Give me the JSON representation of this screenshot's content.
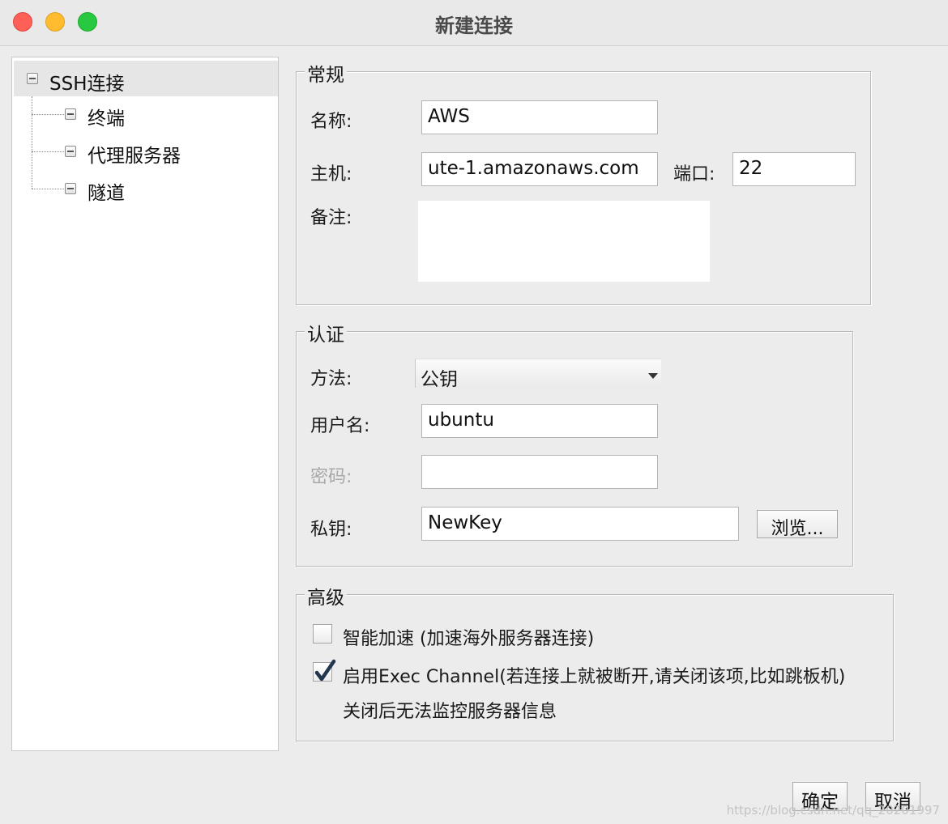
{
  "window": {
    "title": "新建连接"
  },
  "tree": {
    "root": "SSH连接",
    "children": [
      "终端",
      "代理服务器",
      "隧道"
    ]
  },
  "general": {
    "legend": "常规",
    "name_label": "名称:",
    "name_value": "AWS",
    "host_label": "主机:",
    "host_value": "ute-1.amazonaws.com",
    "port_label": "端口:",
    "port_value": "22",
    "note_label": "备注:",
    "note_value": ""
  },
  "auth": {
    "legend": "认证",
    "method_label": "方法:",
    "method_value": "公钥",
    "user_label": "用户名:",
    "user_value": "ubuntu",
    "password_label": "密码:",
    "password_value": "",
    "key_label": "私钥:",
    "key_value": "NewKey",
    "browse_label": "浏览..."
  },
  "advanced": {
    "legend": "高级",
    "smart_accel_label": "智能加速 (加速海外服务器连接)",
    "smart_accel_checked": false,
    "exec_channel_label": "启用Exec Channel(若连接上就被断开,请关闭该项,比如跳板机)",
    "exec_channel_checked": true,
    "exec_channel_note": "关闭后无法监控服务器信息"
  },
  "buttons": {
    "ok": "确定",
    "cancel": "取消"
  },
  "watermark": "https://blog.csdn.net/qq_20201997",
  "icons": {
    "tree_node": "collapse-node-icon",
    "check": "checkmark-icon"
  },
  "colors": {
    "close": "#fe5f57",
    "minimize": "#febc2e",
    "zoom": "#28c840"
  }
}
